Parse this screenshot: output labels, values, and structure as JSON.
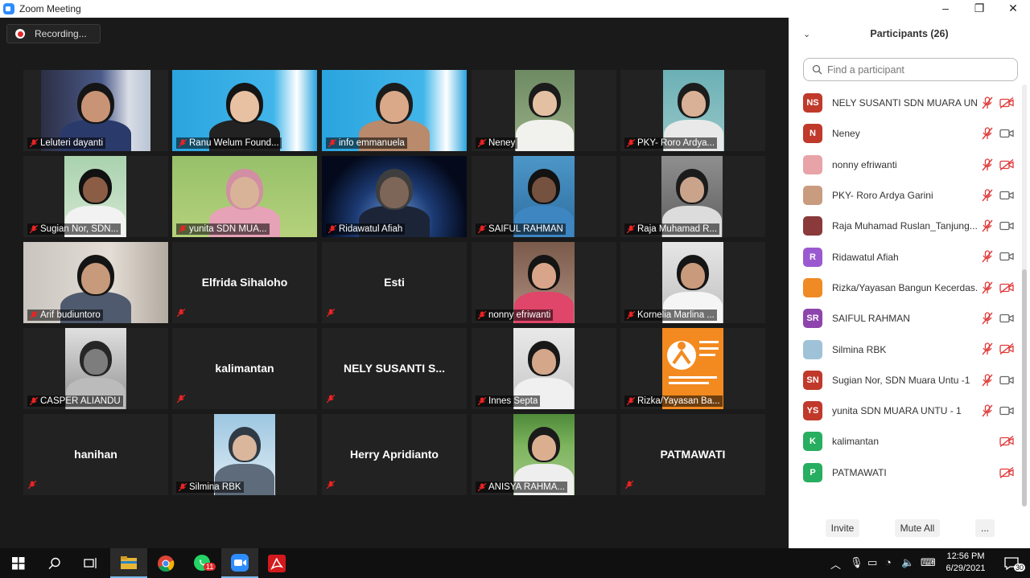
{
  "window": {
    "title": "Zoom Meeting",
    "controls": [
      "–",
      "❐",
      "✕"
    ]
  },
  "recording": {
    "label": "Recording..."
  },
  "gallery": {
    "tiles": [
      {
        "name": "Leluteri dayanti",
        "type": "video"
      },
      {
        "name": "Ranu Welum Found...",
        "type": "video"
      },
      {
        "name": "info emmanuela",
        "type": "video"
      },
      {
        "name": "Neney",
        "type": "video"
      },
      {
        "name": "PKY- Roro Ardya...",
        "type": "video"
      },
      {
        "name": "Sugian Nor, SDN...",
        "type": "video"
      },
      {
        "name": "yunita SDN MUA...",
        "type": "video"
      },
      {
        "name": "Ridawatul Afiah",
        "type": "video"
      },
      {
        "name": "SAIFUL RAHMAN",
        "type": "video"
      },
      {
        "name": "Raja Muhamad R...",
        "type": "video"
      },
      {
        "name": "Arif budiuntoro",
        "type": "video"
      },
      {
        "name": "Elfrida Sihaloho",
        "type": "name"
      },
      {
        "name": "Esti",
        "type": "name"
      },
      {
        "name": "nonny efriwanti",
        "type": "video"
      },
      {
        "name": "Kornelia Marlina ...",
        "type": "video"
      },
      {
        "name": "CASPER ALIANDU",
        "type": "video"
      },
      {
        "name": "kalimantan",
        "type": "name"
      },
      {
        "name": "NELY SUSANTI S...",
        "type": "name"
      },
      {
        "name": "Innes Septa",
        "type": "video"
      },
      {
        "name": "Rizka/Yayasan Ba...",
        "type": "video"
      },
      {
        "name": "hanihan",
        "type": "name"
      },
      {
        "name": "Silmina RBK",
        "type": "video"
      },
      {
        "name": "Herry Apridianto",
        "type": "name"
      },
      {
        "name": "ANISYA RAHMA...",
        "type": "video"
      },
      {
        "name": "PATMAWATI",
        "type": "name"
      }
    ]
  },
  "panel": {
    "title": "Participants (26)",
    "search_placeholder": "Find a participant",
    "participants": [
      {
        "initials": "NS",
        "name": "NELY SUSANTI SDN MUARA UN...",
        "color": "#c0392b",
        "cam_off": true
      },
      {
        "initials": "N",
        "name": "Neney",
        "color": "#c0392b",
        "cam_off": false
      },
      {
        "initials": "",
        "name": "nonny efriwanti",
        "color": "#e8a3a8",
        "cam_off": true
      },
      {
        "initials": "",
        "name": "PKY- Roro Ardya Garini",
        "color": "#c99c80",
        "cam_off": false
      },
      {
        "initials": "",
        "name": "Raja Muhamad Ruslan_Tanjung...",
        "color": "#8a3a3a",
        "cam_off": false
      },
      {
        "initials": "R",
        "name": "Ridawatul Afiah",
        "color": "#9b59d0",
        "cam_off": false
      },
      {
        "initials": "",
        "name": "Rizka/Yayasan Bangun Kecerdas...",
        "color": "#f08a24",
        "cam_off": true
      },
      {
        "initials": "SR",
        "name": "SAIFUL RAHMAN",
        "color": "#8e44ad",
        "cam_off": false
      },
      {
        "initials": "",
        "name": "Silmina RBK",
        "color": "#9fc2d8",
        "cam_off": true
      },
      {
        "initials": "SN",
        "name": "Sugian Nor, SDN Muara Untu -1",
        "color": "#c0392b",
        "cam_off": false
      },
      {
        "initials": "YS",
        "name": "yunita SDN MUARA UNTU - 1",
        "color": "#c0392b",
        "cam_off": false
      },
      {
        "initials": "K",
        "name": "kalimantan",
        "color": "#27ae60",
        "cam_off": true,
        "no_mic": true
      },
      {
        "initials": "P",
        "name": "PATMAWATI",
        "color": "#27ae60",
        "cam_off": true,
        "no_mic": true
      }
    ],
    "buttons": {
      "invite": "Invite",
      "mute_all": "Mute All",
      "more": "..."
    }
  },
  "taskbar": {
    "time": "12:56 PM",
    "date": "6/29/2021",
    "whatsapp_badge": "11",
    "notif_count": "30"
  }
}
